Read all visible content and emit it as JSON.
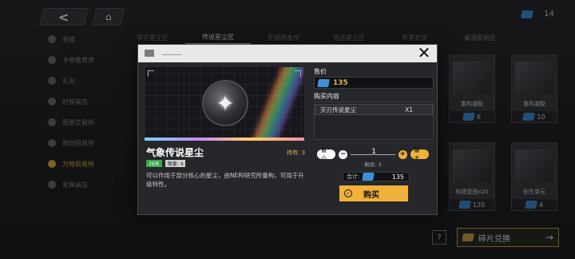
{
  "topbar": {
    "back_glyph": "<",
    "home_glyph": "⌂",
    "currency_value": "14"
  },
  "sidebar": {
    "items": [
      {
        "label": "充值"
      },
      {
        "label": "卡带推荐序"
      },
      {
        "label": "礼包"
      },
      {
        "label": "时装商店"
      },
      {
        "label": "图册交易所"
      },
      {
        "label": "限时贸易所"
      },
      {
        "label": "万物贸易所"
      },
      {
        "label": "家具商店"
      }
    ],
    "active_index": 6
  },
  "tabs": [
    {
      "label": "罕见星尘区"
    },
    {
      "label": "传说星尘区"
    },
    {
      "label": "拓展研发所"
    },
    {
      "label": "自选星尘区"
    },
    {
      "label": "异星友谊"
    },
    {
      "label": "桌游贸易区"
    }
  ],
  "shop_cards": [
    {
      "name": "重构凝胶",
      "price": "6"
    },
    {
      "name": "重构凝胶",
      "price": "10"
    },
    {
      "name": "构建蓝图x20",
      "price": "120"
    },
    {
      "name": "创生单元",
      "price": "4"
    }
  ],
  "bottom": {
    "help_glyph": "?",
    "exchange_label": "碎片兑换",
    "exchange_arrow": "→"
  },
  "modal": {
    "close_glyph": "✕",
    "item_name": "气象传说星尘",
    "owned": "持有: 3",
    "tag_days": "29天",
    "tag_limit": "限量: 4",
    "description": "可以作用于部分核心的星尘，由NERI研究所重构，可用于升级特性。",
    "price_title": "售价",
    "price_value": "135",
    "contents_title": "购买内容",
    "contents": [
      {
        "name": "灭刃传说星尘",
        "qty": "X1"
      }
    ],
    "min_label": "最小",
    "max_label": "最大",
    "minus_glyph": "−",
    "plus_glyph": "+",
    "quantity": "1",
    "remaining": "剩余: 3",
    "total_label": "合计:",
    "total_value": "135",
    "buy_label": "购买",
    "buy_check_glyph": "✓"
  },
  "colors": {
    "accent": "#f0b23a",
    "price_text": "#e5b14a",
    "tag_green": "#3aa64a"
  }
}
